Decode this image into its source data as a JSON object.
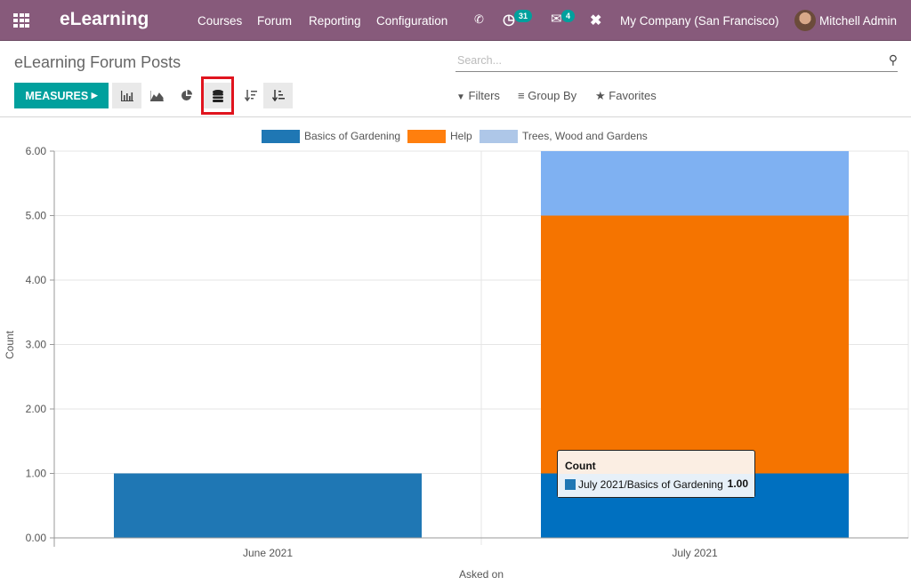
{
  "navbar": {
    "app_name": "eLearning",
    "menu": [
      "Courses",
      "Forum",
      "Reporting",
      "Configuration"
    ],
    "activity_count": "31",
    "messages_count": "4",
    "company": "My Company (San Francisco)",
    "user": "Mitchell Admin",
    "icons": {
      "apps": "apps-grid-icon",
      "phone": "phone-icon",
      "activity": "clock-icon",
      "messages": "chat-icon",
      "debug": "tools-icon"
    }
  },
  "control_panel": {
    "title": "eLearning Forum Posts",
    "measures_label": "MEASURES",
    "search_placeholder": "Search...",
    "filters_label": "Filters",
    "group_by_label": "Group By",
    "favorites_label": "Favorites",
    "view_buttons": [
      "bar-chart",
      "line-chart",
      "pie-chart",
      "stacked",
      "descending",
      "ascending"
    ],
    "highlighted_button": "stacked"
  },
  "tooltip": {
    "title": "Count",
    "label": "July 2021/Basics of Gardening",
    "value": "1.00",
    "color": "#1f77b4"
  },
  "chart_data": {
    "type": "bar",
    "stacked": true,
    "categories": [
      "June 2021",
      "July 2021"
    ],
    "series": [
      {
        "name": "Basics of Gardening",
        "values": [
          1,
          1
        ],
        "color": "#1f77b4"
      },
      {
        "name": "Help",
        "values": [
          0,
          4
        ],
        "color": "#ff7f0e"
      },
      {
        "name": "Trees, Wood and Gardens",
        "values": [
          0,
          1
        ],
        "color": "#aec7e8"
      }
    ],
    "hovered": {
      "category": "July 2021",
      "colors": {
        "Basics of Gardening": "#0070c0",
        "Help": "#f57400",
        "Trees, Wood and Gardens": "#7fb1f2"
      }
    },
    "title": "",
    "xlabel": "Asked on",
    "ylabel": "Count",
    "ylim": [
      0,
      6
    ],
    "yticks": [
      "0.00",
      "1.00",
      "2.00",
      "3.00",
      "4.00",
      "5.00",
      "6.00"
    ],
    "grid": true,
    "legend": "top-center"
  }
}
